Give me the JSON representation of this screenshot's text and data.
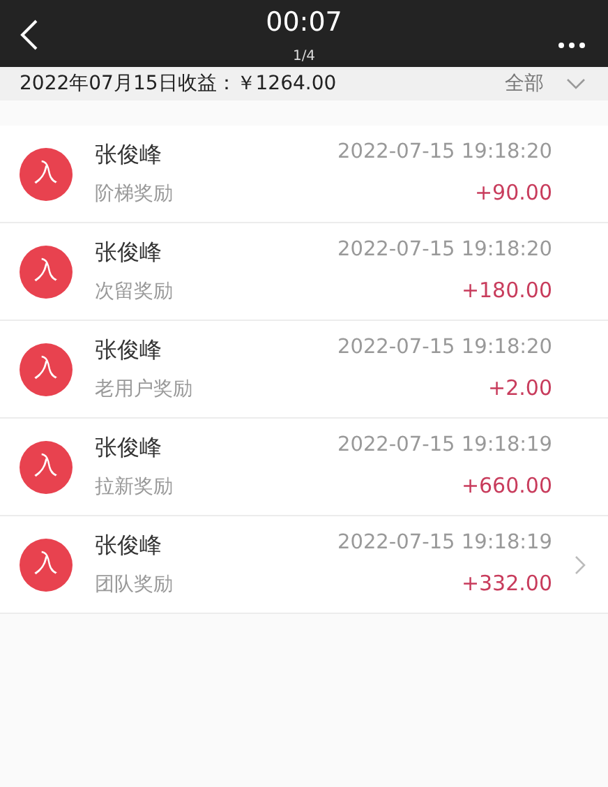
{
  "header": {
    "title": "00:07",
    "subtitle": "1/4"
  },
  "summary": {
    "text": "2022年07月15日收益：￥1264.00",
    "filter": "全部"
  },
  "records": [
    {
      "badge": "入",
      "name": "张俊峰",
      "type": "阶梯奖励",
      "time": "2022-07-15 19:18:20",
      "amount": "+90.00",
      "chevron": false
    },
    {
      "badge": "入",
      "name": "张俊峰",
      "type": "次留奖励",
      "time": "2022-07-15 19:18:20",
      "amount": "+180.00",
      "chevron": false
    },
    {
      "badge": "入",
      "name": "张俊峰",
      "type": "老用户奖励",
      "time": "2022-07-15 19:18:20",
      "amount": "+2.00",
      "chevron": false
    },
    {
      "badge": "入",
      "name": "张俊峰",
      "type": "拉新奖励",
      "time": "2022-07-15 19:18:19",
      "amount": "+660.00",
      "chevron": false
    },
    {
      "badge": "入",
      "name": "张俊峰",
      "type": "团队奖励",
      "time": "2022-07-15 19:18:19",
      "amount": "+332.00",
      "chevron": true
    }
  ]
}
